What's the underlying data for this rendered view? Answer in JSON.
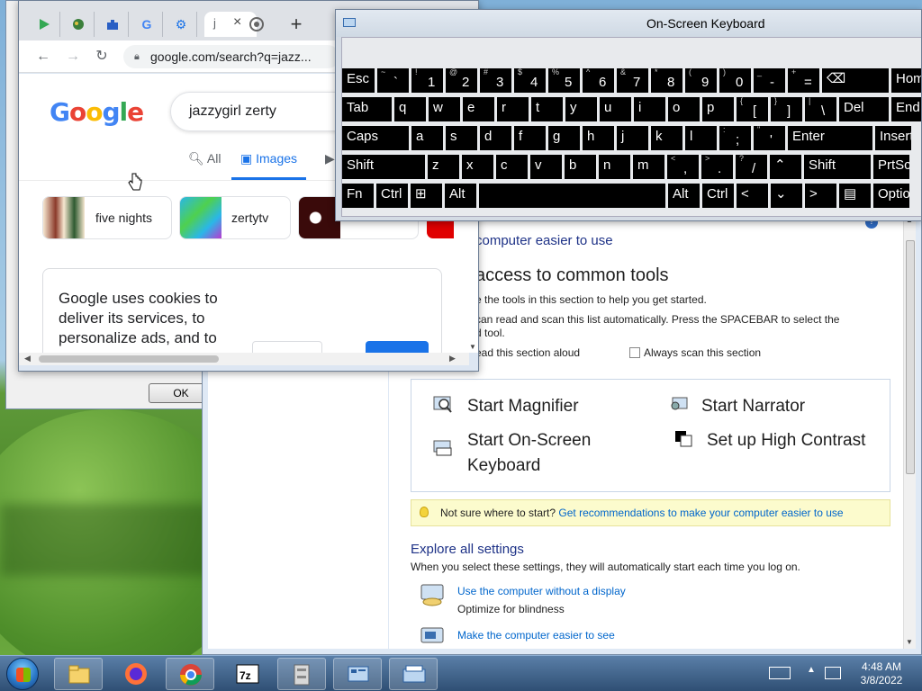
{
  "chrome": {
    "tabs": [
      {
        "icon": "play-store-icon"
      },
      {
        "icon": "green-app-icon"
      },
      {
        "icon": "puzzle-icon"
      },
      {
        "icon": "google-icon"
      },
      {
        "icon": "settings-gear-icon"
      },
      {
        "icon": "active-tab",
        "label": "j"
      },
      {
        "icon": "chrome-icon"
      }
    ],
    "close_glyph": "×",
    "new_tab_glyph": "+",
    "back_glyph": "←",
    "forward_glyph": "→",
    "reload_glyph": "↻",
    "url": "google.com/search?q=jazz...",
    "search_query": "jazzygirl zerty",
    "search_tabs": [
      "All",
      "Images"
    ],
    "chips": [
      "five nights",
      "zertytv"
    ],
    "cookie_text": "Google uses cookies to deliver its services, to personalize ads, and to"
  },
  "osk": {
    "title": "On-Screen Keyboard",
    "rows": [
      [
        {
          "label": "Esc",
          "w": 36
        },
        {
          "shift": "~",
          "main": "`",
          "w": 35
        },
        {
          "shift": "!",
          "main": "1",
          "w": 35
        },
        {
          "shift": "@",
          "main": "2",
          "w": 35
        },
        {
          "shift": "#",
          "main": "3",
          "w": 35
        },
        {
          "shift": "$",
          "main": "4",
          "w": 35
        },
        {
          "shift": "%",
          "main": "5",
          "w": 35
        },
        {
          "shift": "^",
          "main": "6",
          "w": 35
        },
        {
          "shift": "&",
          "main": "7",
          "w": 35
        },
        {
          "shift": "*",
          "main": "8",
          "w": 35
        },
        {
          "shift": "(",
          "main": "9",
          "w": 35
        },
        {
          "shift": ")",
          "main": "0",
          "w": 35
        },
        {
          "shift": "_",
          "main": "-",
          "w": 35
        },
        {
          "shift": "+",
          "main": "=",
          "w": 35
        },
        {
          "label": "⌫",
          "w": 74
        },
        {
          "label": "Home",
          "w": 40
        }
      ],
      [
        {
          "label": "Tab",
          "w": 55
        },
        {
          "label": "q",
          "w": 35
        },
        {
          "label": "w",
          "w": 35
        },
        {
          "label": "e",
          "w": 35
        },
        {
          "label": "r",
          "w": 35
        },
        {
          "label": "t",
          "w": 35
        },
        {
          "label": "y",
          "w": 35
        },
        {
          "label": "u",
          "w": 35
        },
        {
          "label": "i",
          "w": 35
        },
        {
          "label": "o",
          "w": 35
        },
        {
          "label": "p",
          "w": 35
        },
        {
          "shift": "{",
          "main": "[",
          "w": 35
        },
        {
          "shift": "}",
          "main": "]",
          "w": 35
        },
        {
          "shift": "|",
          "main": "\\",
          "w": 35
        },
        {
          "label": "Del",
          "w": 55
        },
        {
          "label": "End",
          "w": 40
        }
      ],
      [
        {
          "label": "Caps",
          "w": 74
        },
        {
          "label": "a",
          "w": 35
        },
        {
          "label": "s",
          "w": 35
        },
        {
          "label": "d",
          "w": 35
        },
        {
          "label": "f",
          "w": 35
        },
        {
          "label": "g",
          "w": 35
        },
        {
          "label": "h",
          "w": 35
        },
        {
          "label": "j",
          "w": 35
        },
        {
          "label": "k",
          "w": 35
        },
        {
          "label": "l",
          "w": 35
        },
        {
          "shift": ":",
          "main": ";",
          "w": 35
        },
        {
          "shift": "\"",
          "main": "'",
          "w": 35
        },
        {
          "label": "Enter",
          "w": 94
        },
        {
          "label": "Insert",
          "w": 40
        }
      ],
      [
        {
          "label": "Shift",
          "w": 92
        },
        {
          "label": "z",
          "w": 35
        },
        {
          "label": "x",
          "w": 35
        },
        {
          "label": "c",
          "w": 35
        },
        {
          "label": "v",
          "w": 35
        },
        {
          "label": "b",
          "w": 35
        },
        {
          "label": "n",
          "w": 35
        },
        {
          "label": "m",
          "w": 35
        },
        {
          "shift": "<",
          "main": ",",
          "w": 35
        },
        {
          "shift": ">",
          "main": ".",
          "w": 35
        },
        {
          "shift": "?",
          "main": "/",
          "w": 35
        },
        {
          "label": "⌃",
          "w": 35
        },
        {
          "label": "Shift",
          "w": 74
        },
        {
          "label": "PrtScn",
          "w": 40
        }
      ],
      [
        {
          "label": "Fn",
          "w": 35
        },
        {
          "label": "Ctrl",
          "w": 35
        },
        {
          "label": "⊞",
          "w": 35
        },
        {
          "label": "Alt",
          "w": 35
        },
        {
          "label": "",
          "w": 207
        },
        {
          "label": "Alt",
          "w": 35
        },
        {
          "label": "Ctrl",
          "w": 35
        },
        {
          "label": "<",
          "w": 35
        },
        {
          "label": "⌄",
          "w": 35
        },
        {
          "label": ">",
          "w": 35
        },
        {
          "label": "▤",
          "w": 35
        },
        {
          "label": "Options",
          "w": 40
        }
      ]
    ]
  },
  "ease": {
    "make_easier": "computer easier to use",
    "quick_access_title": "access to common tools",
    "help_text1": "e the tools in this section to help you get started.",
    "help_text2a": "can read and scan this list automatically.  Press the SPACEBAR to select the",
    "help_text2b": "d tool.",
    "read_aloud": "ead this section aloud",
    "always_scan": "Always scan this section",
    "tools": {
      "magnifier": "Start Magnifier",
      "narrator": "Start Narrator",
      "osk_line1": "Start On-Screen",
      "osk_line2": "Keyboard",
      "high_contrast": "Set up High Contrast"
    },
    "tip_text": "Not sure where to start?",
    "tip_link": "Get recommendations to make your computer easier to use",
    "explore_title": "Explore all settings",
    "explore_desc": "When you select these settings, they will automatically start each time you log on.",
    "setting1_link": "Use the computer without a display",
    "setting1_desc": "Optimize for blindness",
    "setting2_link": "Make the computer easier to see"
  },
  "dialog": {
    "ok": "OK"
  },
  "taskbar": {
    "apps": [
      "windows-explorer-icon",
      "firefox-icon",
      "chrome-icon",
      "7zip-icon",
      "file-cabinet-icon",
      "control-panel-icon",
      "on-screen-keyboard-icon"
    ],
    "time": "4:48 AM",
    "date": "3/8/2022"
  },
  "colors": {
    "accent": "#1a73e8",
    "link": "#0066cc",
    "heading": "#1e3287",
    "tip_bg": "#fcfbcd"
  }
}
